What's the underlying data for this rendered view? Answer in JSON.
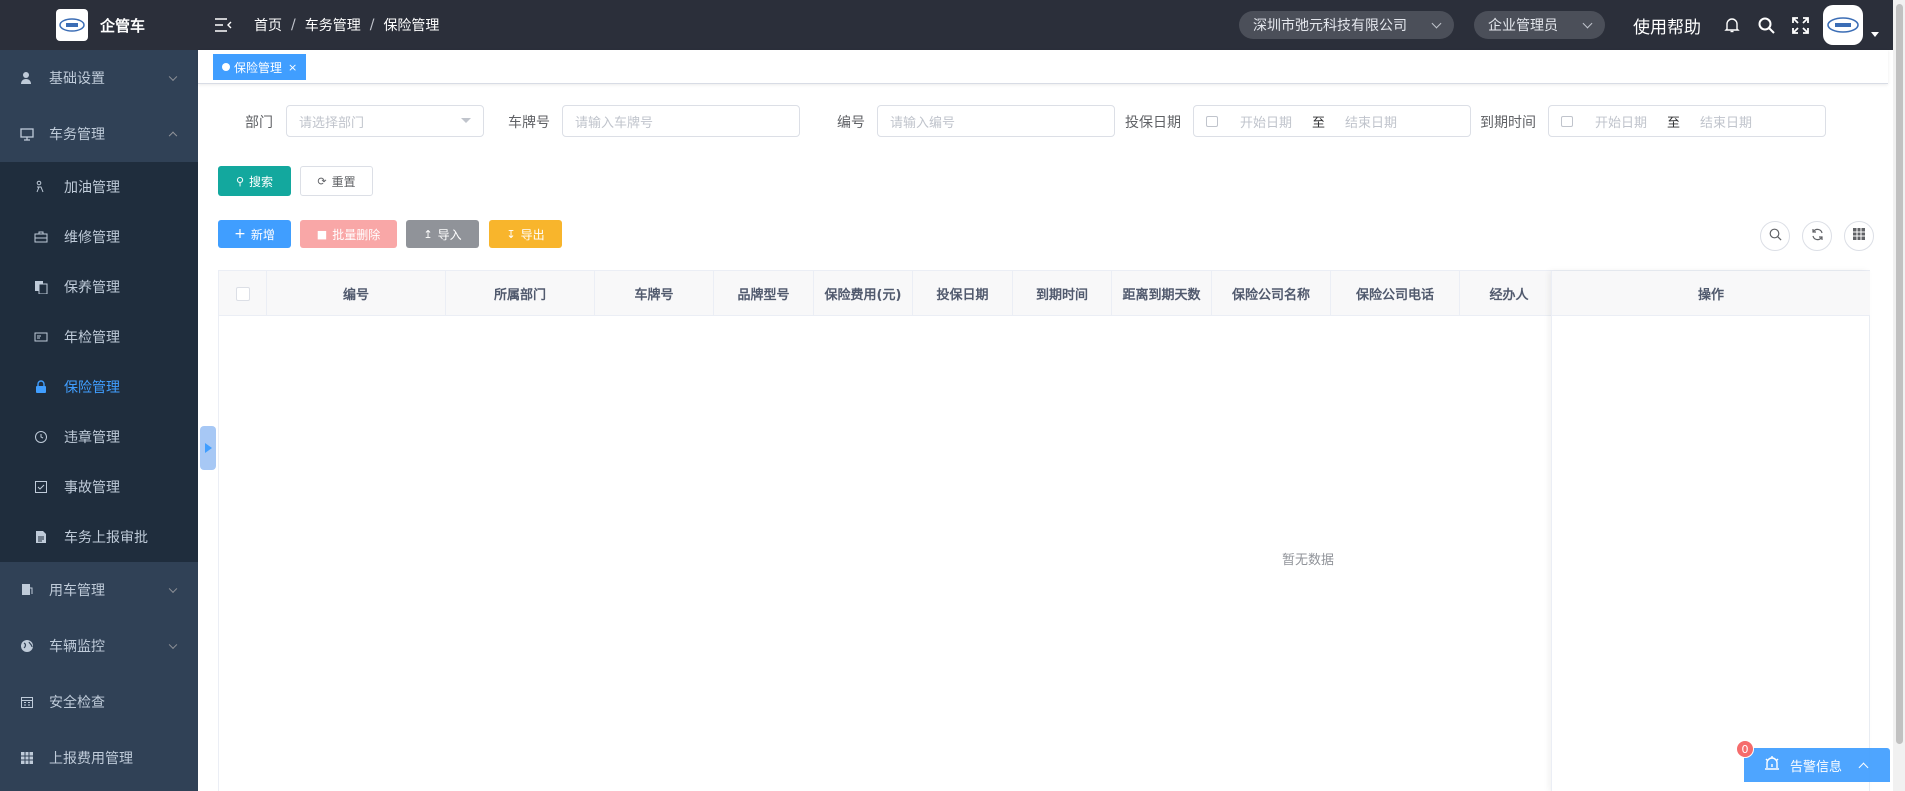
{
  "app": {
    "name": "企管车"
  },
  "sidebar": {
    "items": [
      {
        "label": "基础设置",
        "icon": "user-settings-icon",
        "expanded": false
      },
      {
        "label": "车务管理",
        "icon": "monitor-icon",
        "expanded": true,
        "children": [
          {
            "label": "加油管理",
            "icon": "fuel-icon"
          },
          {
            "label": "维修管理",
            "icon": "toolbox-icon"
          },
          {
            "label": "保养管理",
            "icon": "copy-icon"
          },
          {
            "label": "年检管理",
            "icon": "id-card-icon"
          },
          {
            "label": "保险管理",
            "icon": "lock-icon",
            "active": true
          },
          {
            "label": "违章管理",
            "icon": "clock-icon"
          },
          {
            "label": "事故管理",
            "icon": "checkbox-icon"
          },
          {
            "label": "车务上报审批",
            "icon": "document-icon"
          }
        ]
      },
      {
        "label": "用车管理",
        "icon": "car-use-icon",
        "expanded": false
      },
      {
        "label": "车辆监控",
        "icon": "globe-icon",
        "expanded": false
      },
      {
        "label": "安全检查",
        "icon": "calendar-icon"
      },
      {
        "label": "上报费用管理",
        "icon": "grid-icon"
      }
    ]
  },
  "header": {
    "breadcrumb": [
      "首页",
      "车务管理",
      "保险管理"
    ],
    "company": "深圳市弛元科技有限公司",
    "role": "企业管理员",
    "help": "使用帮助"
  },
  "tags": {
    "active": "保险管理",
    "close": "×"
  },
  "filters": {
    "department": {
      "label": "部门",
      "placeholder": "请选择部门"
    },
    "plate": {
      "label": "车牌号",
      "placeholder": "请输入车牌号"
    },
    "code": {
      "label": "编号",
      "placeholder": "请输入编号"
    },
    "insure_date": {
      "label": "投保日期",
      "start": "开始日期",
      "sep": "至",
      "end": "结束日期"
    },
    "expire_date": {
      "label": "到期时间",
      "start": "开始日期",
      "sep": "至",
      "end": "结束日期"
    }
  },
  "buttons": {
    "search": "搜索",
    "reset": "重置",
    "add": "新增",
    "batch_delete": "批量删除",
    "import": "导入",
    "export": "导出"
  },
  "table": {
    "columns": [
      "编号",
      "所属部门",
      "车牌号",
      "品牌型号",
      "保险费用(元)",
      "投保日期",
      "到期时间",
      "距离到期天数",
      "保险公司名称",
      "保险公司电话",
      "经办人"
    ],
    "actions_column": "操作",
    "empty": "暂无数据"
  },
  "alarm": {
    "label": "告警信息",
    "count": "0"
  },
  "colors": {
    "primary": "#409eff",
    "success": "#13a89e",
    "danger": "#f56c6c",
    "warning": "#f8b52c",
    "sidebar": "#304156",
    "header": "#2b2f3a"
  }
}
